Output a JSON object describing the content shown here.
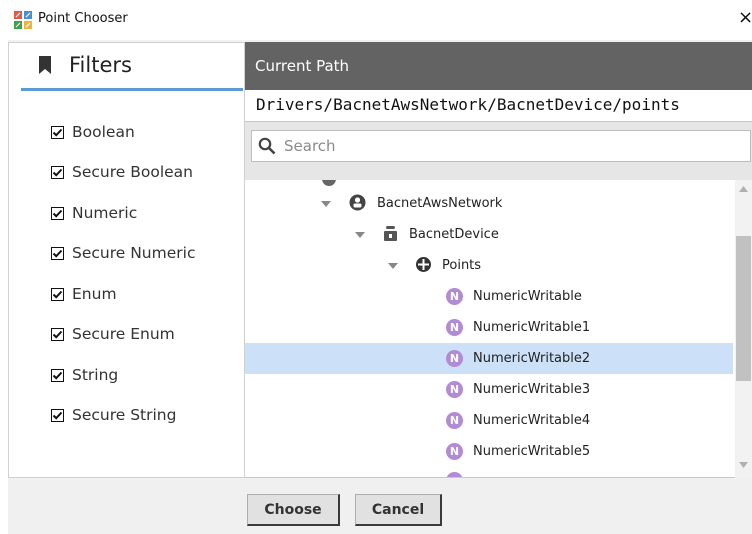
{
  "window": {
    "title": "Point Chooser",
    "close_glyph": "×",
    "icon": "point-chooser-app-icon"
  },
  "filters": {
    "title": "Filters",
    "icon": "bookmark-icon",
    "items": [
      {
        "label": "Boolean",
        "checked": true
      },
      {
        "label": "Secure Boolean",
        "checked": true
      },
      {
        "label": "Numeric",
        "checked": true
      },
      {
        "label": "Secure Numeric",
        "checked": true
      },
      {
        "label": "Enum",
        "checked": true
      },
      {
        "label": "Secure Enum",
        "checked": true
      },
      {
        "label": "String",
        "checked": true
      },
      {
        "label": "Secure String",
        "checked": true
      }
    ]
  },
  "path": {
    "header": "Current Path",
    "value": "Drivers/BacnetAwsNetwork/BacnetDevice/points"
  },
  "search": {
    "placeholder": "Search",
    "value": ""
  },
  "tree": {
    "nodes": [
      {
        "label": "BacnetAwsNetwork",
        "icon": "network-icon",
        "expanded": true
      },
      {
        "label": "BacnetDevice",
        "icon": "device-icon",
        "expanded": true
      },
      {
        "label": "Points",
        "icon": "points-folder-icon",
        "expanded": true
      },
      {
        "label": "NumericWritable",
        "icon": "numeric-point-icon",
        "icon_glyph": "N"
      },
      {
        "label": "NumericWritable1",
        "icon": "numeric-point-icon",
        "icon_glyph": "N"
      },
      {
        "label": "NumericWritable2",
        "icon": "numeric-point-icon",
        "icon_glyph": "N",
        "selected": true
      },
      {
        "label": "NumericWritable3",
        "icon": "numeric-point-icon",
        "icon_glyph": "N"
      },
      {
        "label": "NumericWritable4",
        "icon": "numeric-point-icon",
        "icon_glyph": "N"
      },
      {
        "label": "NumericWritable5",
        "icon": "numeric-point-icon",
        "icon_glyph": "N"
      }
    ]
  },
  "buttons": {
    "choose": "Choose",
    "cancel": "Cancel"
  },
  "colors": {
    "path_header_bg": "#636363",
    "selection_bg": "#cce0f8",
    "filters_underline": "#5b9bd5",
    "numeric_icon": "#b28bd6"
  }
}
